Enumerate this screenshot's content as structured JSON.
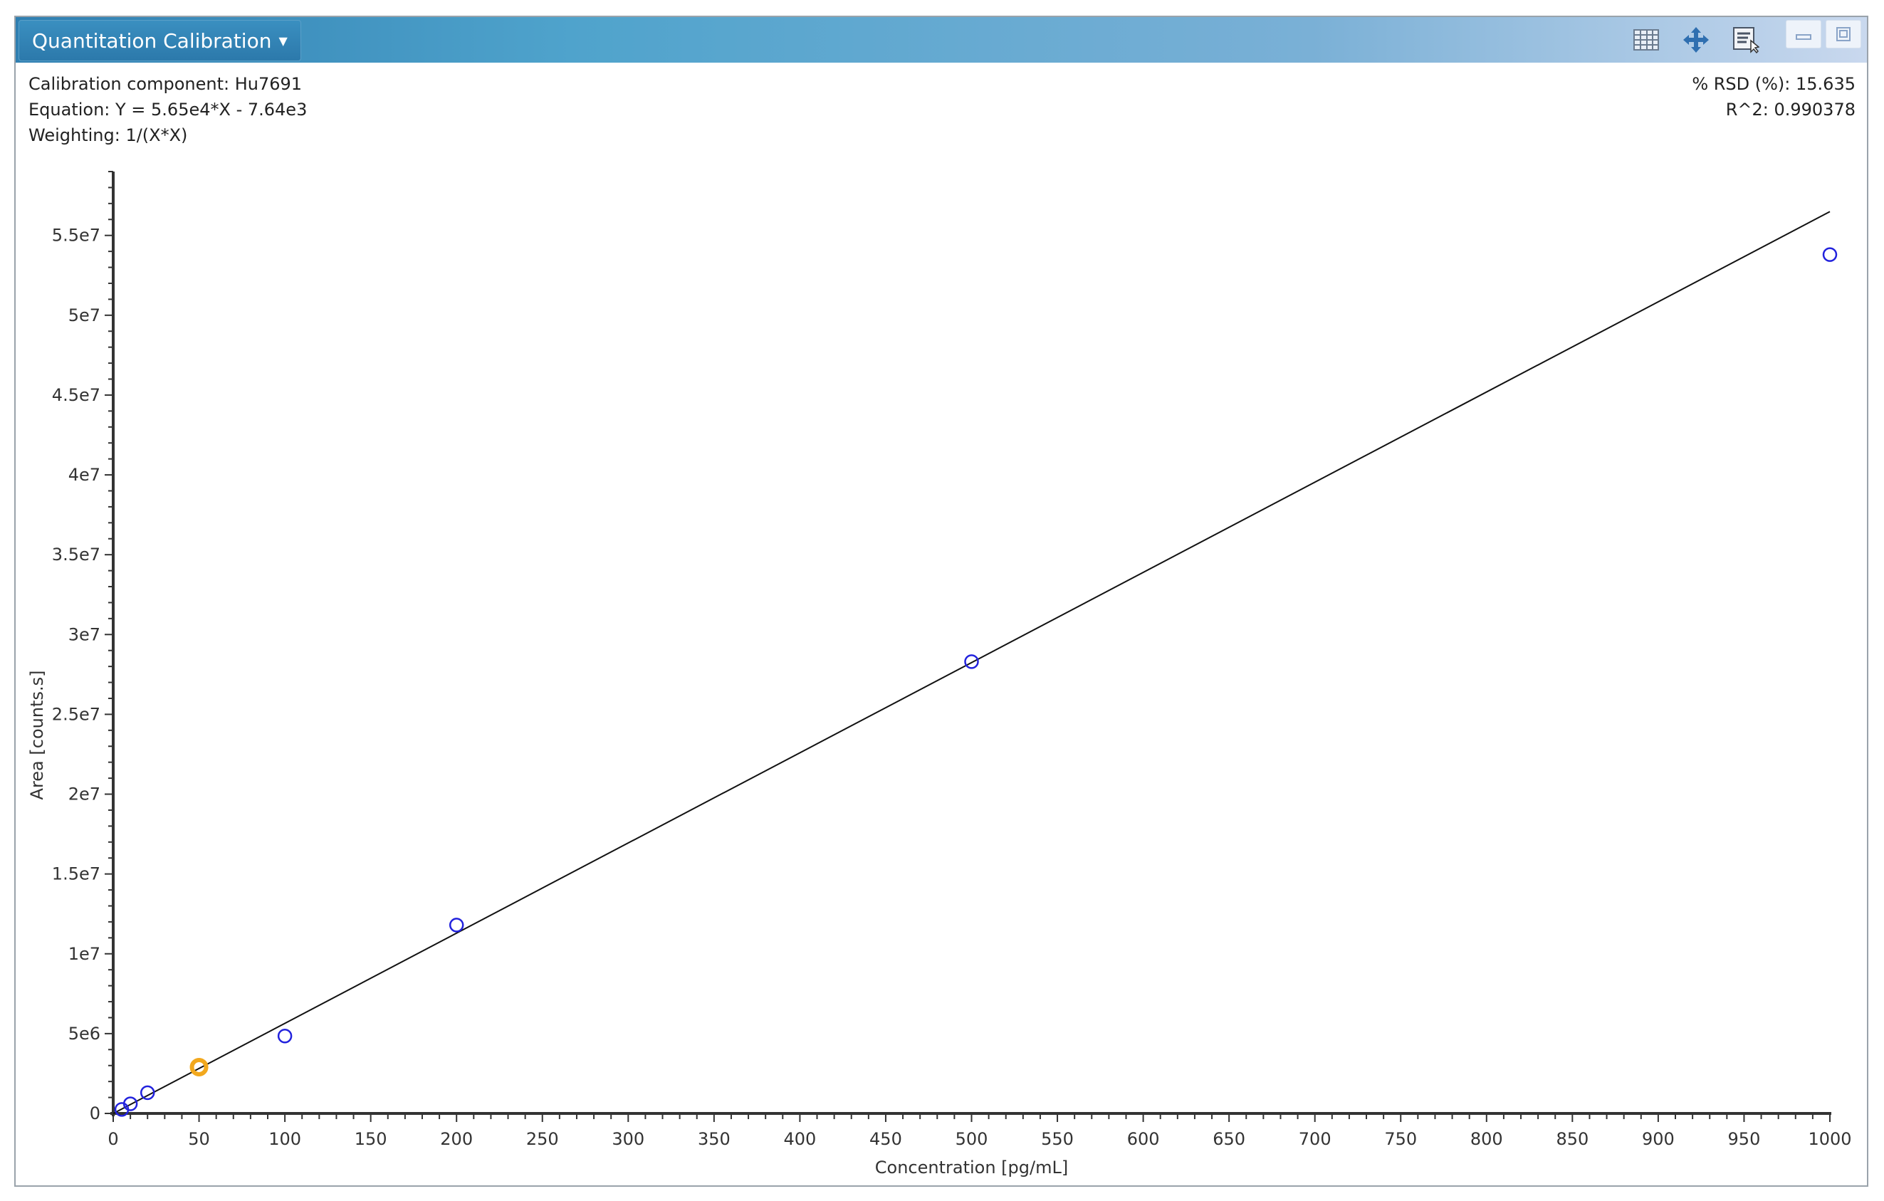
{
  "window": {
    "title": "Quantitation Calibration",
    "toolbar_icons": [
      "table-icon",
      "pan-icon",
      "report-icon"
    ],
    "window_buttons": [
      "minimize-icon",
      "maximize-icon"
    ]
  },
  "info": {
    "component": "Calibration component: Hu7691",
    "equation": "Equation: Y = 5.65e4*X - 7.64e3",
    "weighting": "Weighting: 1/(X*X)",
    "rsd": "% RSD (%): 15.635",
    "r2": "R^2: 0.990378"
  },
  "chart_data": {
    "type": "scatter",
    "title": "",
    "xlabel": "Concentration [pg/mL]",
    "ylabel": "Area [counts.s]",
    "xlim": [
      0,
      1000
    ],
    "ylim": [
      0,
      59000000
    ],
    "xticks": [
      0,
      50,
      100,
      150,
      200,
      250,
      300,
      350,
      400,
      450,
      500,
      550,
      600,
      650,
      700,
      750,
      800,
      850,
      900,
      950,
      1000
    ],
    "yticks": [
      0,
      5000000,
      10000000,
      15000000,
      20000000,
      25000000,
      30000000,
      35000000,
      40000000,
      45000000,
      50000000,
      55000000
    ],
    "ytick_labels": [
      "0",
      "5e6",
      "1e7",
      "1.5e7",
      "2e7",
      "2.5e7",
      "3e7",
      "3.5e7",
      "4e7",
      "4.5e7",
      "5e7",
      "5.5e7"
    ],
    "fit": {
      "slope": 56500,
      "intercept": -7640
    },
    "points": [
      {
        "x": 5,
        "y": 250000,
        "highlight": false
      },
      {
        "x": 10,
        "y": 600000,
        "highlight": false
      },
      {
        "x": 20,
        "y": 1300000,
        "highlight": false
      },
      {
        "x": 50,
        "y": 2900000,
        "highlight": true
      },
      {
        "x": 100,
        "y": 4850000,
        "highlight": false
      },
      {
        "x": 200,
        "y": 11800000,
        "highlight": false
      },
      {
        "x": 500,
        "y": 28300000,
        "highlight": false
      },
      {
        "x": 1000,
        "y": 53800000,
        "highlight": false
      }
    ],
    "colors": {
      "point": "#2222dd",
      "highlight": "#f2a81d",
      "line": "#111111"
    },
    "grid": false
  }
}
